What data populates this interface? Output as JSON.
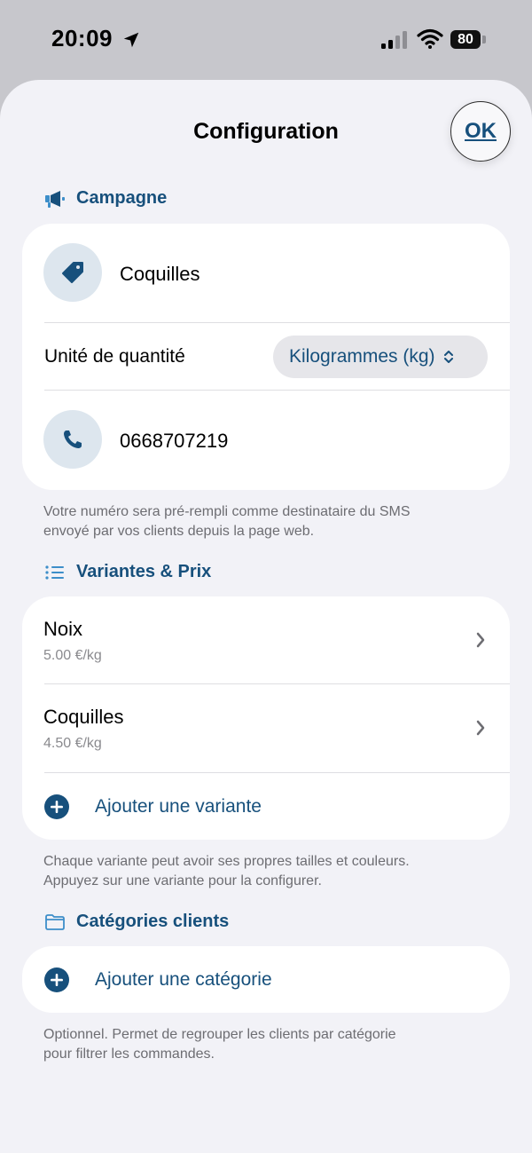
{
  "status_bar": {
    "time": "20:09",
    "battery": "80",
    "icons": [
      "location-arrow-icon",
      "cellular-signal-icon",
      "wifi-icon",
      "battery-icon"
    ]
  },
  "sheet": {
    "title": "Configuration",
    "ok_label": "OK"
  },
  "campaign": {
    "header": "Campagne",
    "header_icon": "megaphone-icon",
    "name": "Coquilles",
    "name_icon": "tag-icon",
    "unit_label": "Unité de quantité",
    "unit_value": "Kilogrammes (kg)",
    "phone": "0668707219",
    "phone_icon": "phone-icon",
    "footnote_line1": "Votre numéro sera pré-rempli comme destinataire du SMS",
    "footnote_line2": "envoyé par vos clients depuis la page web."
  },
  "variants": {
    "header": "Variantes & Prix",
    "header_icon": "list-icon",
    "items": [
      {
        "name": "Noix",
        "price": "5.00 €/kg"
      },
      {
        "name": "Coquilles",
        "price": "4.50 €/kg"
      }
    ],
    "add_label": "Ajouter une variante",
    "footnote_line1": "Chaque variante peut avoir ses propres tailles et couleurs.",
    "footnote_line2": "Appuyez sur une variante pour la configurer."
  },
  "categories": {
    "header": "Catégories clients",
    "header_icon": "folder-icon",
    "add_label": "Ajouter une catégorie",
    "footnote_line1": "Optionnel. Permet de regrouper les clients par catégorie",
    "footnote_line2": "pour filtrer les commandes."
  },
  "colors": {
    "accent": "#17507c",
    "icon_bg": "#dde6ee",
    "sheet_bg": "#f2f2f7",
    "card_bg": "#ffffff",
    "secondary_text": "#6d6d72"
  }
}
